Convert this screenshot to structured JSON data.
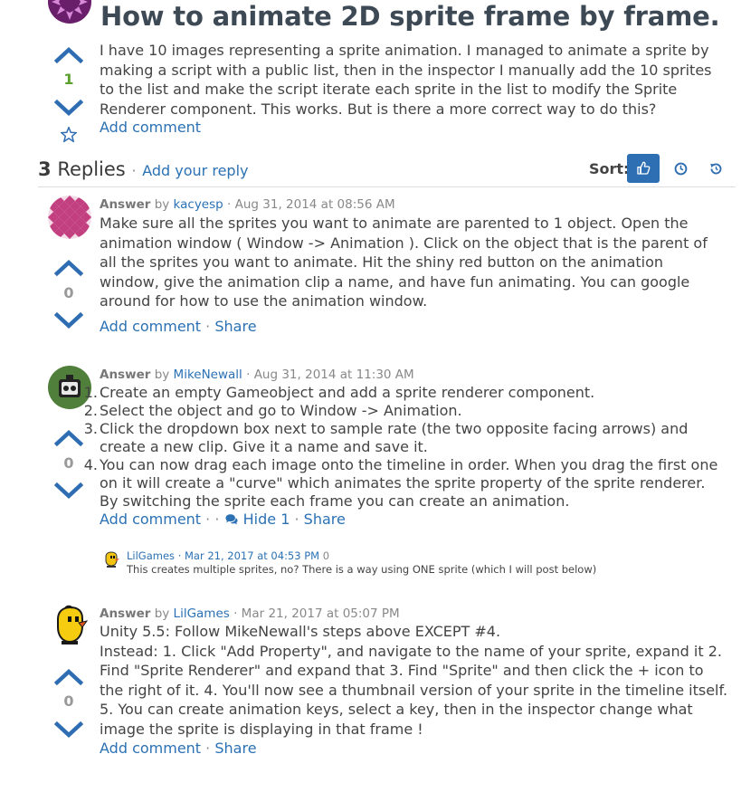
{
  "question": {
    "title": "How to animate 2D sprite frame by frame.",
    "body": "I have 10 images representing a sprite animation. I managed to animate a sprite by making a script with a public list, then in the inspector I manually add the 10 sprites to the list and make the script iterate each sprite in the list to modify the Sprite Renderer component. This works. But is there a more correct way to do this?",
    "votes": "1",
    "add_comment": "Add comment"
  },
  "replies": {
    "count": "3",
    "label": "Replies",
    "separator": "·",
    "add_reply": "Add your reply",
    "sort_label": "Sort:"
  },
  "answers": [
    {
      "label": "Answer",
      "by": "by",
      "author": "kacyesp",
      "date": "· Aug 31, 2014 at 08:56 AM",
      "body": "Make sure all the sprites you want to animate are parented to 1 object. Open the animation window ( Window -> Animation ). Click on the object that is the parent of all the sprites you want to animate. Hit the shiny red button on the animation window, give the animation clip a name, and have fun animating. You can google around for how to use the animation window.",
      "votes": "0",
      "add_comment": "Add comment",
      "sep": "·",
      "share": "Share"
    },
    {
      "label": "Answer",
      "by": "by",
      "author": "MikeNewall",
      "date": "· Aug 31, 2014 at 11:30 AM",
      "steps": [
        {
          "num": "1.",
          "text": "Create an empty Gameobject and add a sprite renderer component."
        },
        {
          "num": "2.",
          "text": "Select the object and go to Window -> Animation."
        },
        {
          "num": "3.",
          "text": "Click the dropdown box next to sample rate (the two opposite facing arrows) and create a new clip. Give it a name and save it."
        },
        {
          "num": "4.",
          "text": "You can now drag each image onto the timeline in order. When you drag the first one on it will create a \"curve\" which animates the sprite property of the sprite renderer. By switching the sprite each frame you can create an animation."
        }
      ],
      "votes": "0",
      "add_comment": "Add comment",
      "sep1": "·  ·",
      "hide": "Hide 1",
      "sep": "·",
      "share": "Share",
      "comment": {
        "author": "LilGames",
        "date": "· Mar 21, 2017 at 04:53 PM",
        "votes": "0",
        "text": "This creates multiple sprites, no? There is a way using ONE sprite (which I will post below)"
      }
    },
    {
      "label": "Answer",
      "by": "by",
      "author": "LilGames",
      "date": "· Mar 21, 2017 at 05:07 PM",
      "line1": "Unity 5.5: Follow MikeNewall's steps above EXCEPT #4.",
      "body": "Instead: 1. Click \"Add Property\", and navigate to the name of your sprite, expand it 2. Find \"Sprite Renderer\" and expand that 3. Find \"Sprite\" and then click the + icon to the right of it. 4. You'll now see a thumbnail version of your sprite in the timeline itself. 5. You can create animation keys, select a key, then in the inspector change what image the sprite is displaying in that frame !",
      "votes": "0",
      "add_comment": "Add comment",
      "sep": "·",
      "share": "Share"
    }
  ],
  "colors": {
    "accent": "#2b71b4",
    "vote_arrow": "#2f6db2",
    "vote_positive": "#5aa02c",
    "sort_active_bg": "#2e6fb3"
  },
  "icons": {
    "upvote": "chevron-up-icon",
    "downvote": "chevron-down-icon",
    "favorite": "star-icon",
    "sort_votes": "thumbs-up-icon",
    "sort_newest": "clock-icon",
    "sort_oldest": "history-icon",
    "comments": "comments-icon"
  }
}
